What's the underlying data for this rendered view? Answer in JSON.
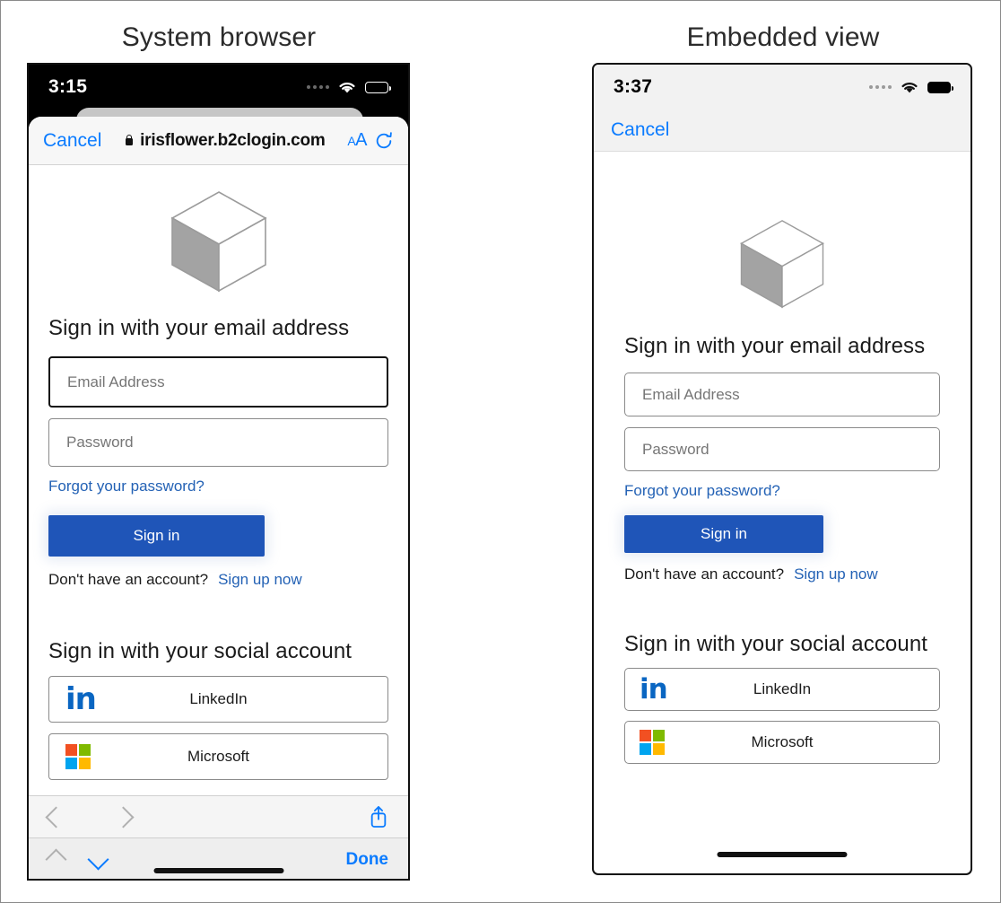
{
  "headings": {
    "left": "System browser",
    "right": "Embedded view"
  },
  "colors": {
    "ios_blue": "#0a7bff",
    "b2c_blue": "#1f55b8",
    "link_blue": "#2462b5",
    "linkedin_blue": "#0a66c2",
    "ms_red": "#f25022",
    "ms_green": "#7fba00",
    "ms_blue": "#00a4ef",
    "ms_yellow": "#ffb900"
  },
  "left_panel": {
    "status_bar": {
      "time": "3:15",
      "signal_icon": "signal-dots-icon",
      "wifi_icon": "wifi-icon",
      "battery_icon": "battery-icon"
    },
    "safari_bar": {
      "cancel_label": "Cancel",
      "lock_icon": "lock-icon",
      "url": "irisflower.b2clogin.com",
      "text_size_label_small": "A",
      "text_size_label_large": "A",
      "reload_icon": "reload-icon"
    },
    "toolbar": {
      "back_icon": "chevron-left-icon",
      "forward_icon": "chevron-right-icon",
      "share_icon": "share-icon"
    },
    "keyboard_accessory": {
      "prev_icon": "chevron-up-icon",
      "next_icon": "chevron-down-icon",
      "done_label": "Done"
    }
  },
  "right_panel": {
    "status_bar": {
      "time": "3:37",
      "signal_icon": "signal-dots-icon",
      "wifi_icon": "wifi-icon",
      "battery_icon": "battery-icon"
    },
    "nav_bar": {
      "cancel_label": "Cancel"
    }
  },
  "b2c_form": {
    "logo_icon": "cube-logo-icon",
    "email_heading": "Sign in with your email address",
    "email_placeholder": "Email Address",
    "password_placeholder": "Password",
    "forgot_password_label": "Forgot your password?",
    "signin_label": "Sign in",
    "no_account_text": "Don't have an account?",
    "signup_label": "Sign up now",
    "social_heading": "Sign in with your social account",
    "social_buttons": [
      {
        "label": "LinkedIn",
        "icon": "linkedin-icon"
      },
      {
        "label": "Microsoft",
        "icon": "microsoft-icon"
      }
    ]
  }
}
